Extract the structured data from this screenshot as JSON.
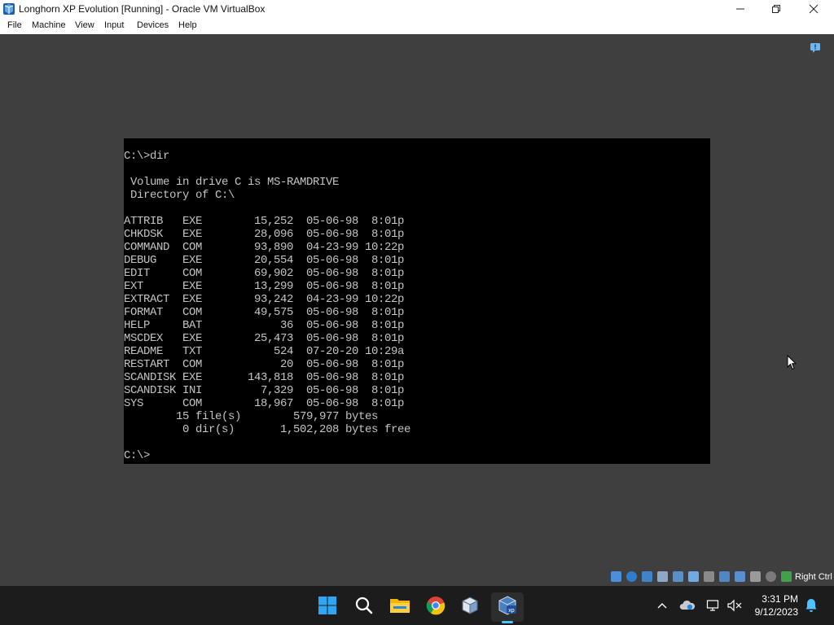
{
  "window": {
    "title": "Longhorn XP Evolution [Running] - Oracle VM VirtualBox",
    "icon": "virtualbox-icon",
    "controls": [
      "minimize",
      "maximize",
      "close"
    ]
  },
  "menu": {
    "items": [
      "File",
      "Machine",
      "View",
      "Input",
      "Devices",
      "Help"
    ]
  },
  "console": {
    "lines": [
      "C:\\>dir",
      "",
      " Volume in drive C is MS-RAMDRIVE",
      " Directory of C:\\",
      "",
      "ATTRIB   EXE        15,252  05-06-98  8:01p",
      "CHKDSK   EXE        28,096  05-06-98  8:01p",
      "COMMAND  COM        93,890  04-23-99 10:22p",
      "DEBUG    EXE        20,554  05-06-98  8:01p",
      "EDIT     COM        69,902  05-06-98  8:01p",
      "EXT      EXE        13,299  05-06-98  8:01p",
      "EXTRACT  EXE        93,242  04-23-99 10:22p",
      "FORMAT   COM        49,575  05-06-98  8:01p",
      "HELP     BAT            36  05-06-98  8:01p",
      "MSCDEX   EXE        25,473  05-06-98  8:01p",
      "README   TXT           524  07-20-20 10:29a",
      "RESTART  COM            20  05-06-98  8:01p",
      "SCANDISK EXE       143,818  05-06-98  8:01p",
      "SCANDISK INI         7,329  05-06-98  8:01p",
      "SYS      COM        18,967  05-06-98  8:01p",
      "        15 file(s)        579,977 bytes",
      "         0 dir(s)       1,502,208 bytes free",
      "",
      "C:\\>"
    ]
  },
  "statusbar": {
    "host_key_label": "Right Ctrl",
    "icons": [
      "hard-disk-icon",
      "optical-drive-icon",
      "floppy-icon",
      "audio-icon",
      "network-icon",
      "usb-icon",
      "shared-folders-icon",
      "display-icon",
      "video-capture-icon",
      "recording-icon",
      "virtualization-icon",
      "mouse-integration-icon",
      "keyboard-icon"
    ]
  },
  "taskbar": {
    "apps": [
      "start",
      "search",
      "file-explorer",
      "chrome",
      "virtualbox-manager",
      "virtualbox-vm"
    ],
    "active_app": "virtualbox-vm",
    "tray_icons": [
      "show-hidden-icons",
      "onedrive-icon",
      "network-icon",
      "volume-muted-icon",
      "notifications-bell-icon"
    ],
    "time": "3:31 PM",
    "date": "9/12/2023"
  },
  "colors": {
    "accent": "#4cc2ff",
    "console_text": "#c4c4c4",
    "vm_background": "#3f3f3f"
  }
}
